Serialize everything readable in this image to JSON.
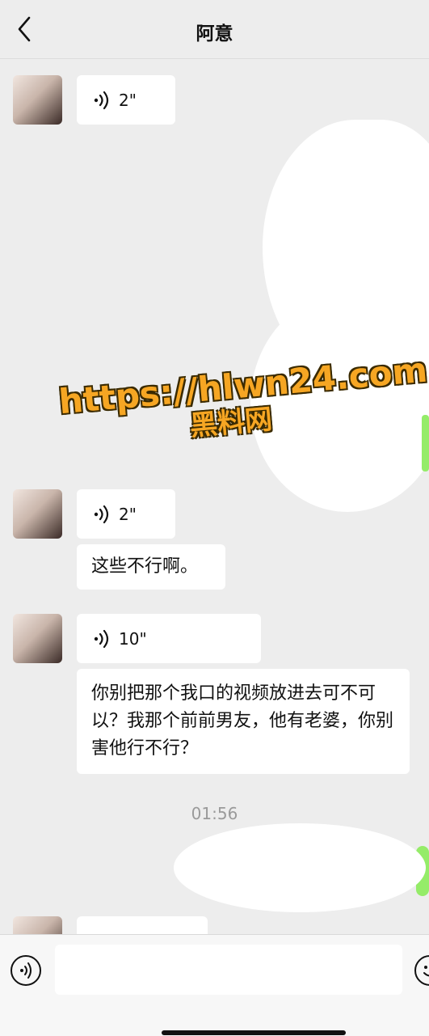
{
  "header": {
    "title": "阿意"
  },
  "messages": [
    {
      "type": "voice",
      "duration": "2\""
    },
    {
      "type": "voice",
      "duration": "2\""
    },
    {
      "type": "text",
      "text": "这些不行啊。"
    },
    {
      "type": "voice",
      "duration": "10\""
    },
    {
      "type": "text",
      "text": "你别把那个我口的视频放进去可不可以？我那个前前男友，他有老婆，你别害他行不行？"
    }
  ],
  "timestamp": "01:56",
  "watermark": {
    "url": "https://hlwn24.com",
    "site": "黑料网"
  },
  "icons": {
    "back": "chevron-left-icon",
    "voice_wave": "voice-wave-icon",
    "voice_input": "voice-input-icon",
    "emoji": "emoji-icon"
  },
  "colors": {
    "background": "#ededed",
    "bubble_incoming": "#ffffff",
    "bubble_outgoing": "#95ec69",
    "timestamp": "#9a9a9a"
  }
}
